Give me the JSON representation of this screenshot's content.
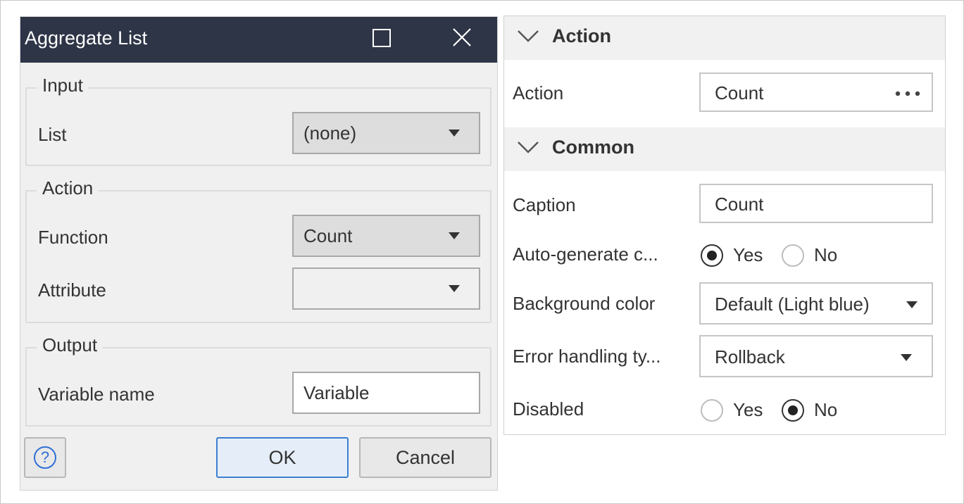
{
  "dialog": {
    "title": "Aggregate List",
    "input": {
      "legend": "Input",
      "list_label": "List",
      "list_value": "(none)"
    },
    "action": {
      "legend": "Action",
      "function_label": "Function",
      "function_value": "Count",
      "attribute_label": "Attribute",
      "attribute_value": ""
    },
    "output": {
      "legend": "Output",
      "variable_label": "Variable name",
      "variable_value": "Variable"
    },
    "help_glyph": "?",
    "ok_label": "OK",
    "cancel_label": "Cancel"
  },
  "properties": {
    "action_section": {
      "title": "Action",
      "action_label": "Action",
      "action_value": "Count"
    },
    "common_section": {
      "title": "Common",
      "caption_label": "Caption",
      "caption_value": "Count",
      "autogen_label": "Auto-generate c...",
      "autogen_yes": "Yes",
      "autogen_no": "No",
      "autogen_selected": "Yes",
      "bgcolor_label": "Background color",
      "bgcolor_value": "Default (Light blue)",
      "error_label": "Error handling ty...",
      "error_value": "Rollback",
      "disabled_label": "Disabled",
      "disabled_yes": "Yes",
      "disabled_no": "No",
      "disabled_selected": "No"
    }
  },
  "colors": {
    "titlebar": "#2e3547",
    "accent": "#3b7fd3",
    "help_icon": "#2f6fd6"
  },
  "icons": {
    "maximize": "maximize-icon",
    "close": "close-icon",
    "chevron": "chevron-down-icon",
    "dropdown": "caret-down-icon",
    "ellipsis": "ellipsis-icon",
    "help": "help-icon"
  }
}
